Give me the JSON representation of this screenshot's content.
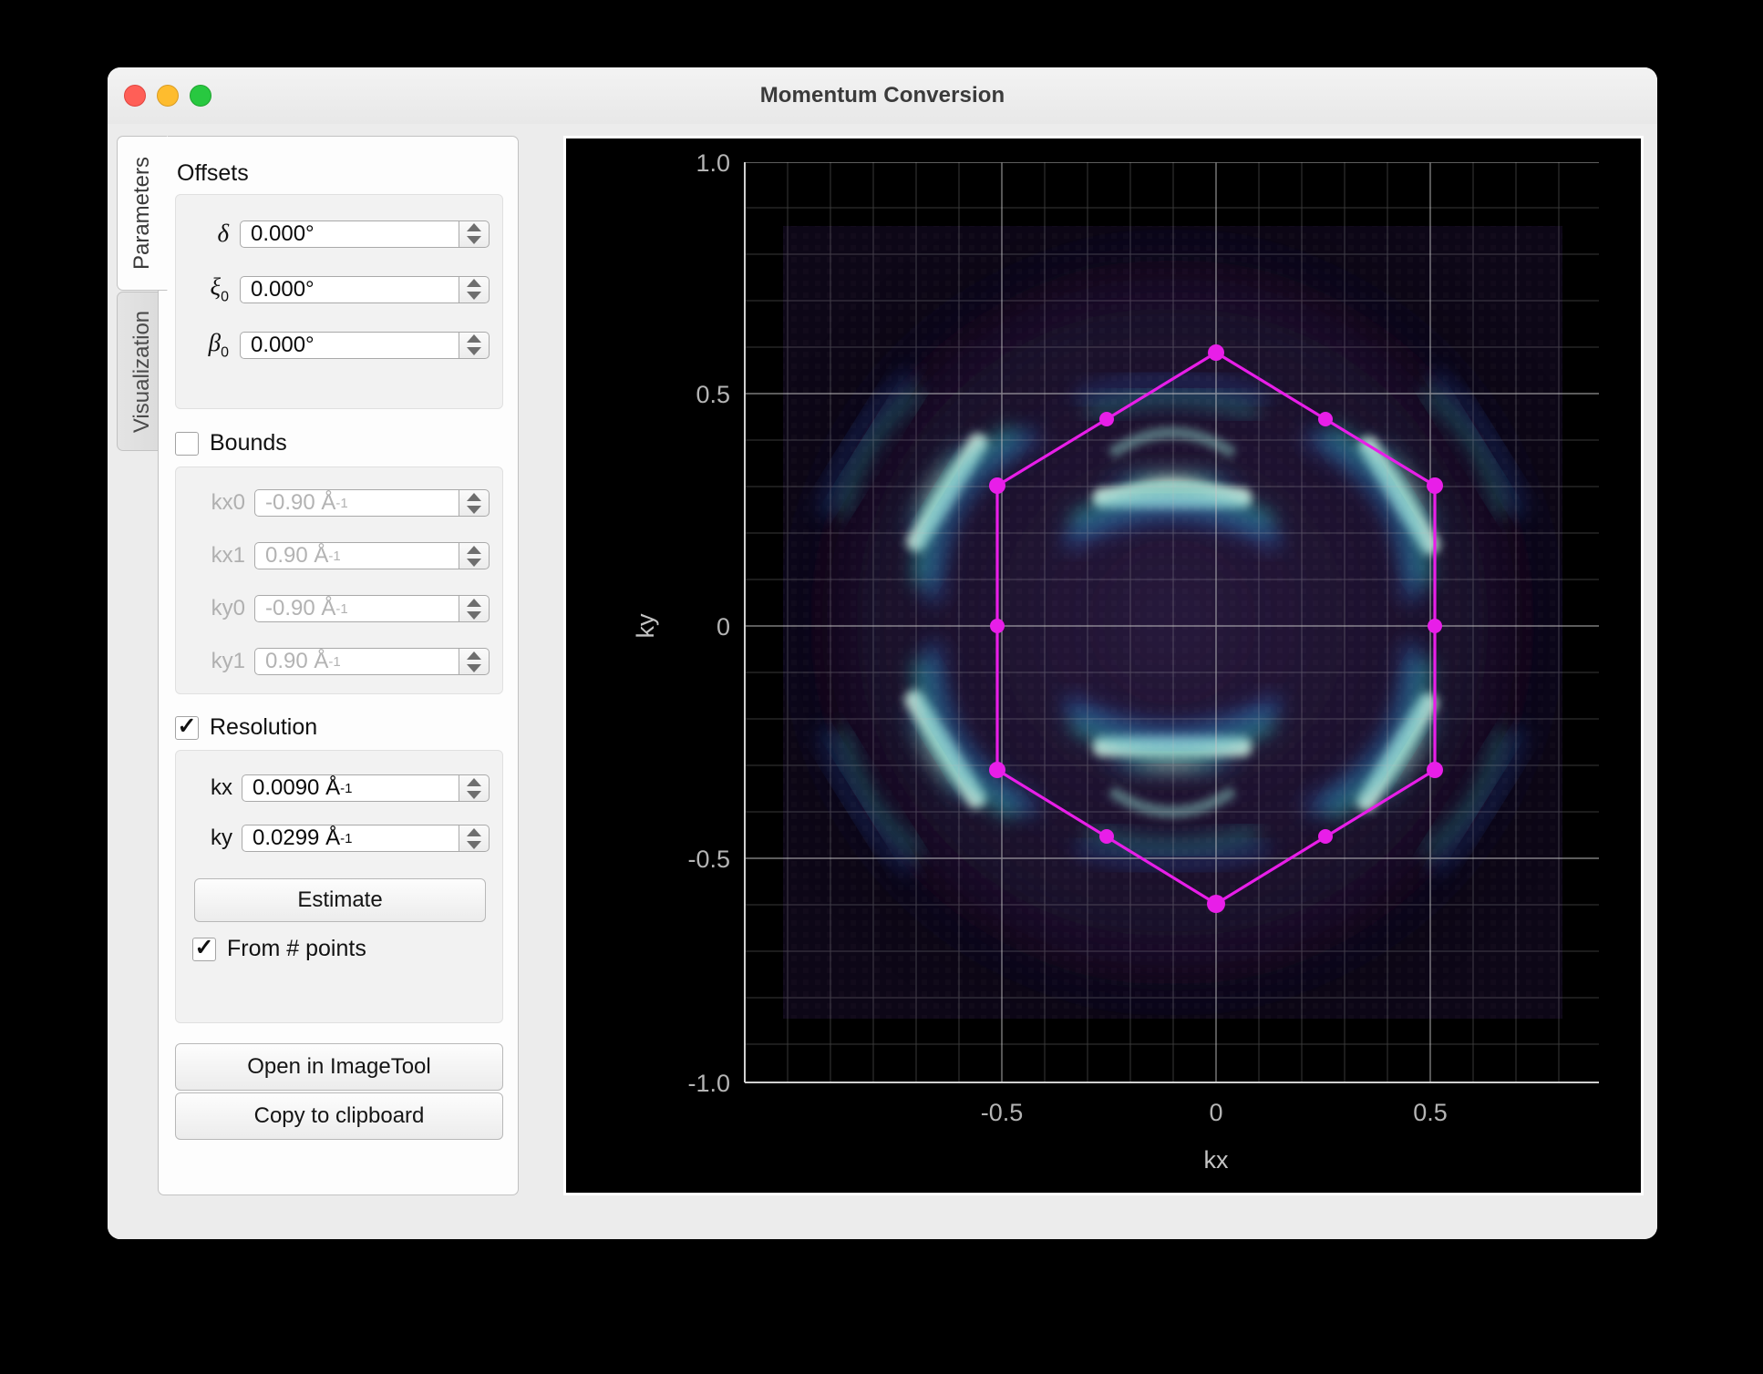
{
  "window": {
    "title": "Momentum Conversion",
    "controls": {
      "close": "close",
      "minimize": "minimize",
      "zoom": "zoom"
    }
  },
  "tabs": [
    {
      "label": "Parameters",
      "selected": true
    },
    {
      "label": "Visualization",
      "selected": false
    }
  ],
  "offsets": {
    "title": "Offsets",
    "fields": [
      {
        "name": "delta",
        "label": "δ",
        "value": "0.000°"
      },
      {
        "name": "xi0",
        "label": "ξ",
        "sub": "0",
        "value": "0.000°"
      },
      {
        "name": "beta0",
        "label": "β",
        "sub": "0",
        "value": "0.000°"
      }
    ]
  },
  "bounds": {
    "label": "Bounds",
    "checked": false,
    "enabled": false,
    "fields": [
      {
        "name": "kx0",
        "label": "kx0",
        "value": "-0.90 Å",
        "exp": "-1"
      },
      {
        "name": "kx1",
        "label": "kx1",
        "value": "0.90 Å",
        "exp": "-1"
      },
      {
        "name": "ky0",
        "label": "ky0",
        "value": "-0.90 Å",
        "exp": "-1"
      },
      {
        "name": "ky1",
        "label": "ky1",
        "value": "0.90 Å",
        "exp": "-1"
      }
    ]
  },
  "resolution": {
    "label": "Resolution",
    "checked": true,
    "fields": [
      {
        "name": "kx",
        "label": "kx",
        "value": "0.0090 Å",
        "exp": "-1"
      },
      {
        "name": "ky",
        "label": "ky",
        "value": "0.0299 Å",
        "exp": "-1"
      }
    ],
    "estimate_button": "Estimate",
    "from_points": {
      "label": "From # points",
      "checked": true
    }
  },
  "actions": [
    {
      "name": "open-in-imagetool",
      "label": "Open in ImageTool"
    },
    {
      "name": "copy-to-clipboard",
      "label": "Copy to clipboard"
    }
  ],
  "colors": {
    "accent_magenta": "#e81ee8",
    "plot_background": "#000000",
    "grid": "#b9b9b9",
    "tick_text": "#b4b4b4",
    "traffic_red": "#ff5f57",
    "traffic_yellow": "#febc2e",
    "traffic_green": "#28c840"
  },
  "chart_data": {
    "type": "heatmap",
    "title": "",
    "xlabel": "kx",
    "ylabel": "ky",
    "xlim": [
      -1.0,
      1.0
    ],
    "ylim": [
      -1.0,
      1.0
    ],
    "xticks": [
      -0.5,
      0,
      0.5
    ],
    "xticklabels": [
      "-0.5",
      "0",
      "0.5"
    ],
    "yticks": [
      -1.0,
      -0.5,
      0,
      0.5,
      1.0
    ],
    "yticklabels": [
      "-1.0",
      "-0.5",
      "0",
      "0.5",
      "1.0"
    ],
    "grid": true,
    "minor_grid": true,
    "colormap": "terrain-dark (black → purple → blue → cyan → white)",
    "description": "ARPES constant-energy map (Fermi surface) showing six bright crescent-shaped intensity pockets arranged hexagonally around the zone centre, on a dark purple background.",
    "data_extent": {
      "kx": [
        -0.9,
        0.9
      ],
      "ky": [
        -0.86,
        0.86
      ]
    },
    "intensity_pockets": [
      {
        "kx": 0.0,
        "ky": 0.55
      },
      {
        "kx": -0.5,
        "ky": 0.27
      },
      {
        "kx": 0.5,
        "ky": 0.27
      },
      {
        "kx": -0.5,
        "ky": -0.29
      },
      {
        "kx": 0.5,
        "ky": -0.29
      },
      {
        "kx": 0.0,
        "ky": -0.56
      }
    ],
    "overlay": {
      "name": "Brillouin zone hexagon",
      "color": "#e81ee8",
      "line_width": 2,
      "marker": "circle",
      "closed": true,
      "vertices": [
        {
          "kx": 0.0,
          "ky": 0.59
        },
        {
          "kx": 0.51,
          "ky": 0.29
        },
        {
          "kx": 0.51,
          "ky": 0.0
        },
        {
          "kx": 0.51,
          "ky": -0.31
        },
        {
          "kx": 0.0,
          "ky": -0.6
        },
        {
          "kx": -0.51,
          "ky": -0.31
        },
        {
          "kx": -0.51,
          "ky": 0.0
        },
        {
          "kx": -0.51,
          "ky": 0.29
        }
      ],
      "midpoints": [
        {
          "kx": -0.26,
          "ky": 0.45
        },
        {
          "kx": 0.26,
          "ky": 0.45
        },
        {
          "kx": 0.26,
          "ky": -0.46
        },
        {
          "kx": -0.26,
          "ky": -0.46
        }
      ]
    }
  }
}
